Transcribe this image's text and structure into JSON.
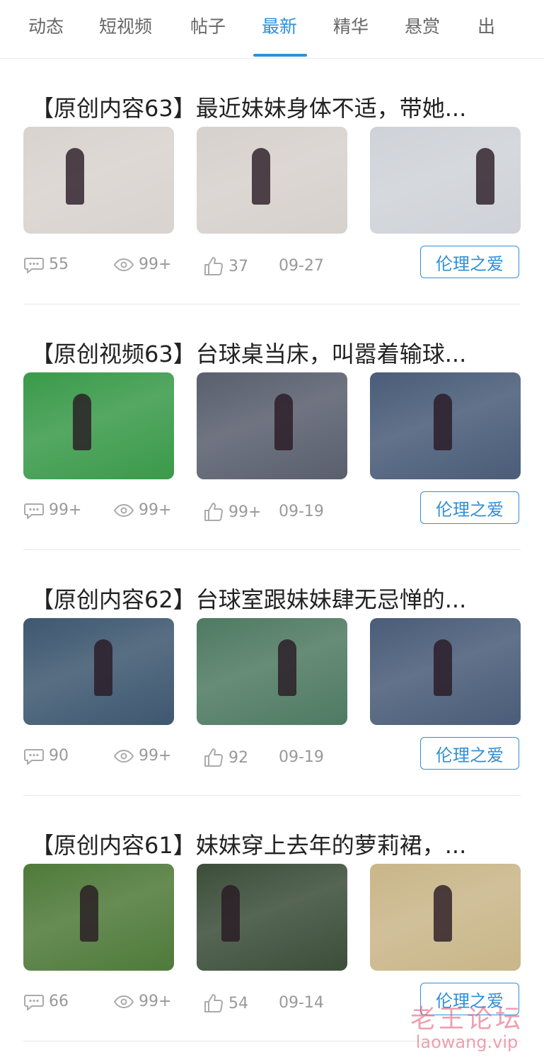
{
  "tabs": [
    {
      "label": "动态",
      "active": false
    },
    {
      "label": "短视频",
      "active": false
    },
    {
      "label": "帖子",
      "active": false
    },
    {
      "label": "最新",
      "active": true
    },
    {
      "label": "精华",
      "active": false
    },
    {
      "label": "悬赏",
      "active": false
    },
    {
      "label": "出",
      "active": false
    }
  ],
  "accent_color": "#2f8fd8",
  "posts": [
    {
      "title": "【原创内容63】最近妹妹身体不适，带她...",
      "comments": "55",
      "views": "99+",
      "likes": "37",
      "date": "09-27",
      "tag": "伦理之爱",
      "thumbs": [
        {
          "bg": "#d9d3cf"
        },
        {
          "bg": "#d7d1cd"
        },
        {
          "bg": "#cfd2d8"
        }
      ]
    },
    {
      "title": "【原创视频63】台球桌当床，叫嚣着输球...",
      "comments": "99+",
      "views": "99+",
      "likes": "99+",
      "date": "09-19",
      "tag": "伦理之爱",
      "thumbs": [
        {
          "bg": "#3a9a4a"
        },
        {
          "bg": "#5a5f6e"
        },
        {
          "bg": "#4a5c78"
        }
      ]
    },
    {
      "title": "【原创内容62】台球室跟妹妹肆无忌惮的...",
      "comments": "90",
      "views": "99+",
      "likes": "92",
      "date": "09-19",
      "tag": "伦理之爱",
      "thumbs": [
        {
          "bg": "#3e5870"
        },
        {
          "bg": "#4f7a62"
        },
        {
          "bg": "#4a5c78"
        }
      ]
    },
    {
      "title": "【原创内容61】妹妹穿上去年的萝莉裙，...",
      "comments": "66",
      "views": "99+",
      "likes": "54",
      "date": "09-14",
      "tag": "伦理之爱",
      "thumbs": [
        {
          "bg": "#4f7a3a"
        },
        {
          "bg": "#3c4e3a"
        },
        {
          "bg": "#c9b689"
        }
      ]
    }
  ],
  "watermark": {
    "line1": "老王论坛",
    "line2": "laowang.vip"
  }
}
